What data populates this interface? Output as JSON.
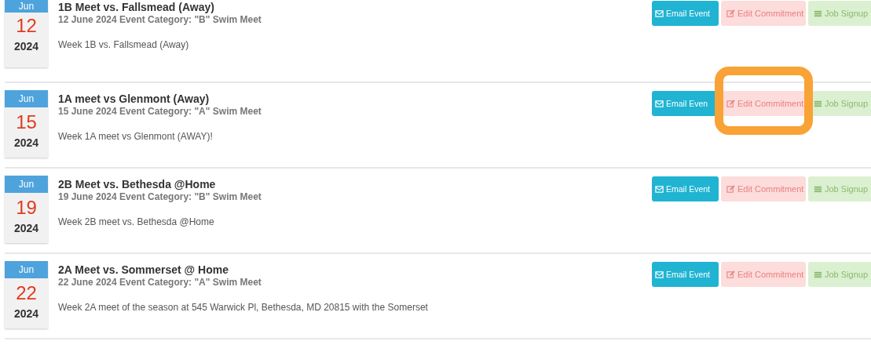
{
  "events": [
    {
      "month": "Jun",
      "day": "12",
      "year": "2024",
      "title": "1B Meet vs. Fallsmead (Away)",
      "subtitle": "12 June 2024 Event Category: \"B\" Swim Meet",
      "description": "Week 1B vs. Fallsmead (Away)",
      "buttons": {
        "email": "Email Event",
        "edit": "Edit Commitment",
        "job": "Job Signup"
      },
      "highlighted": false
    },
    {
      "month": "Jun",
      "day": "15",
      "year": "2024",
      "title": "1A meet vs Glenmont (Away)",
      "subtitle": "15 June 2024 Event Category: \"A\" Swim Meet",
      "description": "Week 1A meet vs Glenmont (AWAY)!",
      "buttons": {
        "email": "Email Even",
        "edit": "Edit Commitment",
        "job": "Job Signup"
      },
      "highlighted": true
    },
    {
      "month": "Jun",
      "day": "19",
      "year": "2024",
      "title": "2B Meet vs. Bethesda @Home",
      "subtitle": "19 June 2024 Event Category: \"B\" Swim Meet",
      "description": "Week 2B meet vs. Bethesda @Home",
      "buttons": {
        "email": "Email Event",
        "edit": "Edit Commitment",
        "job": "Job Signup"
      },
      "highlighted": false
    },
    {
      "month": "Jun",
      "day": "22",
      "year": "2024",
      "title": "2A Meet vs. Sommerset @ Home",
      "subtitle": "22 June 2024 Event Category: \"A\" Swim Meet",
      "description": "Week 2A meet of the season at 545 Warwick Pl, Bethesda, MD 20815 with the Somerset",
      "buttons": {
        "email": "Email Event",
        "edit": "Edit Commitment",
        "job": "Job Signup"
      },
      "highlighted": false
    }
  ]
}
